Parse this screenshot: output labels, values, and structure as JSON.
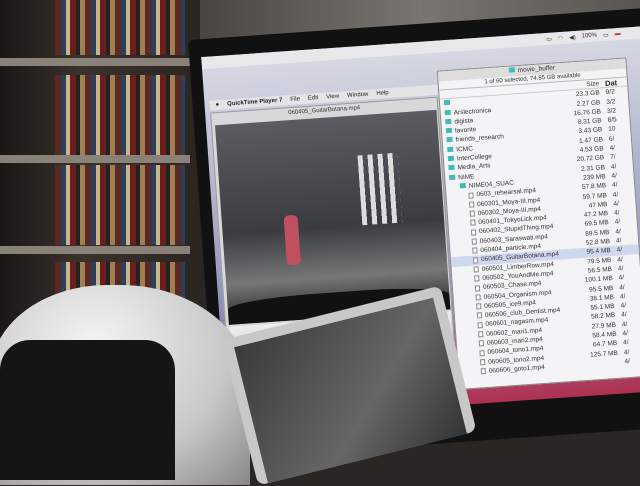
{
  "menubar": {
    "battery": "100%"
  },
  "quicktime": {
    "menu": [
      "QuickTime Player 7",
      "File",
      "Edit",
      "View",
      "Window",
      "Help"
    ],
    "window_title": "060405_GuitarBotana.mp4"
  },
  "finder": {
    "title": "movie_buffer",
    "status": "1 of 60 selected, 74.85 GB available",
    "col_size": "Size",
    "col_date": "Dat",
    "rows": [
      {
        "name": "",
        "size": "23.3 GB",
        "date": "9/2",
        "kind": "folder"
      },
      {
        "name": "Arslectronica",
        "size": "2.27 GB",
        "date": "3/2",
        "kind": "folder"
      },
      {
        "name": "digista",
        "size": "16.76 GB",
        "date": "3/2",
        "kind": "folder"
      },
      {
        "name": "favorite",
        "size": "8.31 GB",
        "date": "8/5",
        "kind": "folder"
      },
      {
        "name": "friends_research",
        "size": "3.43 GB",
        "date": "10",
        "kind": "folder"
      },
      {
        "name": "ICMC",
        "size": "1.47 GB",
        "date": "6/",
        "kind": "folder"
      },
      {
        "name": "InterCollege",
        "size": "4.53 GB",
        "date": "4/",
        "kind": "folder"
      },
      {
        "name": "Media_Arts",
        "size": "20.72 GB",
        "date": "7/",
        "kind": "folder"
      },
      {
        "name": "NIME",
        "size": "2.31 GB",
        "date": "4/",
        "kind": "folder"
      },
      {
        "name": "NIME04_SUAC",
        "size": "239 MB",
        "date": "4/",
        "kind": "folder"
      },
      {
        "name": "0603_rehearsal.mp4",
        "size": "57.8 MB",
        "date": "4/",
        "kind": "file"
      },
      {
        "name": "060301_Moya-III.mp4",
        "size": "59.7 MB",
        "date": "4/",
        "kind": "file"
      },
      {
        "name": "060302_Moya-III.mp4",
        "size": "47 MB",
        "date": "4/",
        "kind": "file"
      },
      {
        "name": "060401_TokyoLick.mp4",
        "size": "47.2 MB",
        "date": "4/",
        "kind": "file"
      },
      {
        "name": "060402_StupidThing.mp4",
        "size": "69.5 MB",
        "date": "4/",
        "kind": "file"
      },
      {
        "name": "060403_Saraswati.mp4",
        "size": "89.5 MB",
        "date": "4/",
        "kind": "file"
      },
      {
        "name": "060404_particle.mp4",
        "size": "52.8 MB",
        "date": "4/",
        "kind": "file"
      },
      {
        "name": "060405_GuitarBotana.mp4",
        "size": "95.4 MB",
        "date": "4/",
        "kind": "file"
      },
      {
        "name": "060501_LimberRow.mp4",
        "size": "79.5 MB",
        "date": "4/",
        "kind": "file"
      },
      {
        "name": "060502_YouAndMe.mp4",
        "size": "56.5 MB",
        "date": "4/",
        "kind": "file"
      },
      {
        "name": "060503_Chase.mp4",
        "size": "100.1 MB",
        "date": "4/",
        "kind": "file"
      },
      {
        "name": "060504_Organism.mp4",
        "size": "95.5 MB",
        "date": "4/",
        "kind": "file"
      },
      {
        "name": "060505_ice9.mp4",
        "size": "38.1 MB",
        "date": "4/",
        "kind": "file"
      },
      {
        "name": "060506_club_Dentist.mp4",
        "size": "55.1 MB",
        "date": "4/",
        "kind": "file"
      },
      {
        "name": "060601_nagasm.mp4",
        "size": "58.2 MB",
        "date": "4/",
        "kind": "file"
      },
      {
        "name": "060602_mari1.mp4",
        "size": "27.9 MB",
        "date": "4/",
        "kind": "file"
      },
      {
        "name": "060603_mari2.mp4",
        "size": "58.4 MB",
        "date": "4/",
        "kind": "file"
      },
      {
        "name": "060604_tono1.mp4",
        "size": "64.7 MB",
        "date": "4/",
        "kind": "file"
      },
      {
        "name": "060605_tono2.mp4",
        "size": "125.7 MB",
        "date": "4/",
        "kind": "file"
      },
      {
        "name": "060606_goto1.mp4",
        "size": "",
        "date": "4/",
        "kind": "file"
      }
    ]
  }
}
